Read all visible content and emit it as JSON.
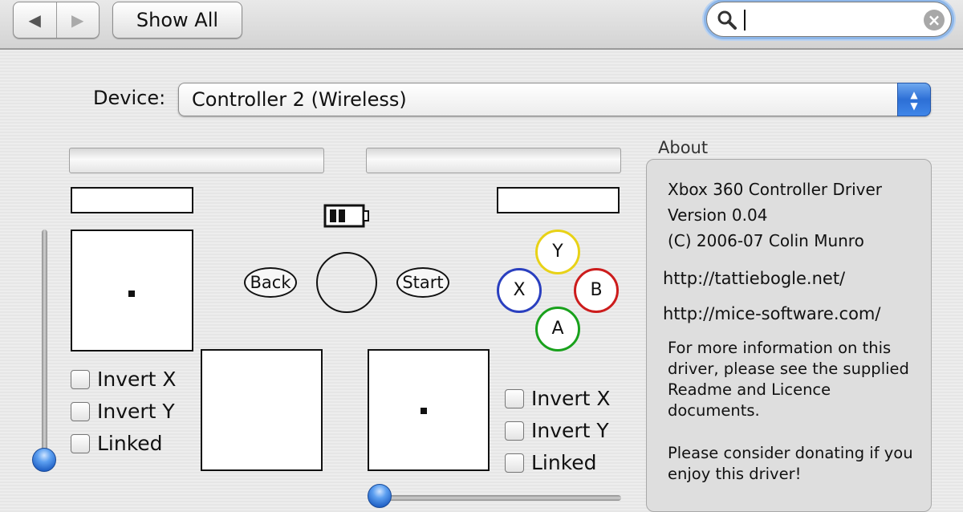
{
  "toolbar": {
    "back_icon": "back-arrow-icon",
    "forward_icon": "forward-arrow-icon",
    "back_glyph": "◀",
    "forward_glyph": "▶",
    "show_all_label": "Show All",
    "search": {
      "value": "",
      "icon": "search-icon",
      "clear_icon": "clear-icon",
      "clear_glyph": "×"
    }
  },
  "device": {
    "label": "Device:",
    "selected": "Controller 2 (Wireless)",
    "arrows_icon": "updown-arrows-icon"
  },
  "controller": {
    "battery_icon": "battery-icon",
    "back_label": "Back",
    "start_label": "Start",
    "face_buttons": {
      "y": {
        "label": "Y",
        "color": "#e8d217"
      },
      "x": {
        "label": "X",
        "color": "#2a3fbf"
      },
      "b": {
        "label": "B",
        "color": "#cc1c1c"
      },
      "a": {
        "label": "A",
        "color": "#19a11c"
      }
    },
    "left_stick": {
      "invert_x": "Invert X",
      "invert_y": "Invert Y",
      "linked": "Linked"
    },
    "right_stick": {
      "invert_x": "Invert X",
      "invert_y": "Invert Y",
      "linked": "Linked"
    }
  },
  "about": {
    "title": "About",
    "name": "Xbox 360 Controller Driver",
    "version": "Version 0.04",
    "copyright": "(C) 2006-07 Colin Munro",
    "url1": "http://tattiebogle.net/",
    "url2": "http://mice-software.com/",
    "info": "For more information on this driver, please see the supplied Readme and Licence documents.",
    "donate": "Please consider donating if you enjoy this driver!"
  },
  "colors": {
    "accent": "#3f86e8",
    "focus_ring": "#8db6e8"
  }
}
